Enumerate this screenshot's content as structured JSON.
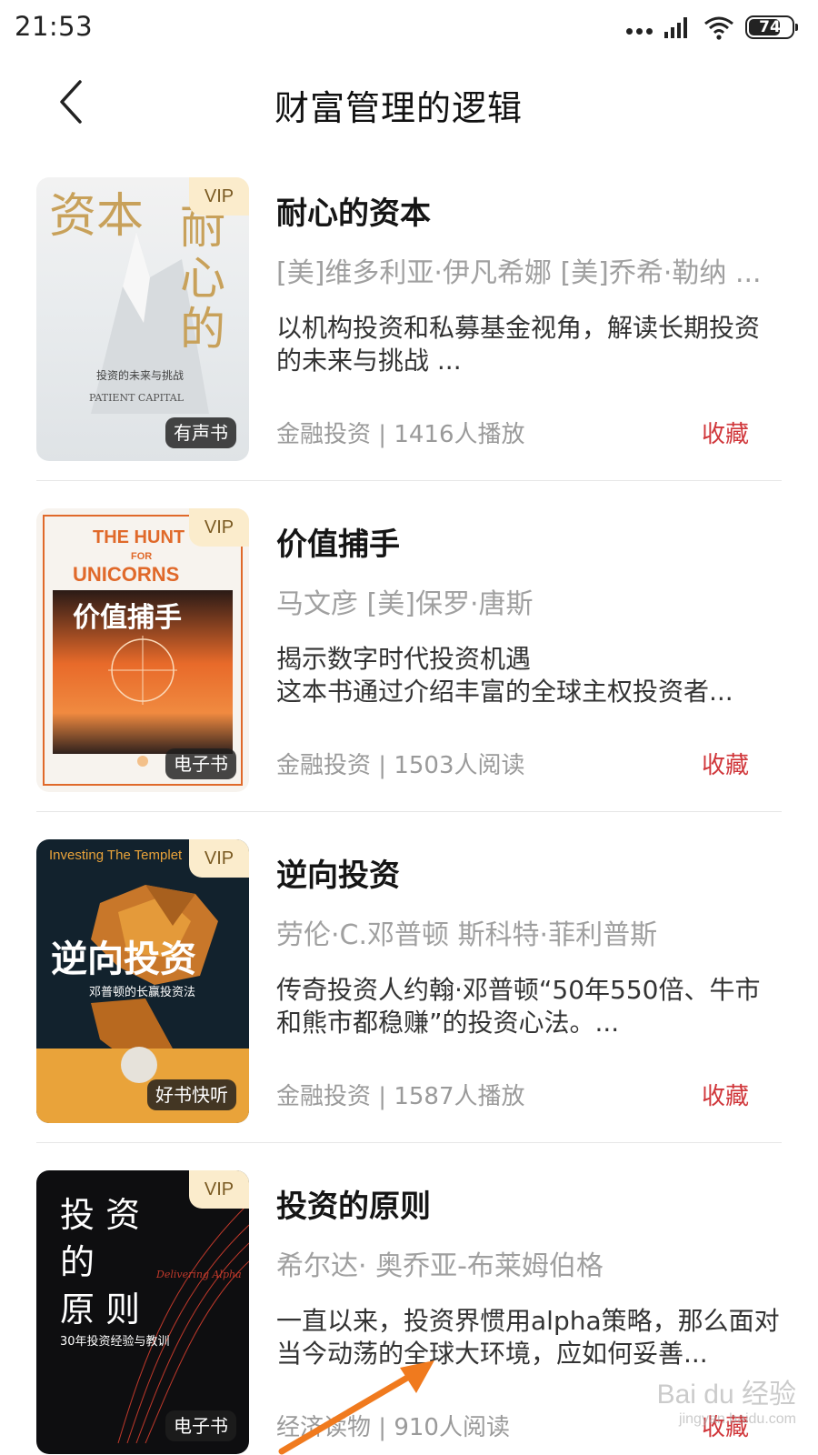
{
  "status_bar": {
    "time": "21:53",
    "battery": "74",
    "battery_level": 0.74
  },
  "header": {
    "back_icon": "chevron-left-icon",
    "title": "财富管理的逻辑"
  },
  "books": [
    {
      "title": "耐心的资本",
      "author": "[美]维多利亚·伊凡希娜 [美]乔希·勒纳 ...",
      "desc": "以机构投资和私募基金视角，解读长期投资的未来与挑战 ...",
      "category": "金融投资",
      "stats": "1416人播放",
      "vip": "VIP",
      "type": "有声书",
      "collect": "收藏",
      "cover": {
        "big_left": "资本",
        "big_right": "耐心的",
        "subtitle": "投资的未来与挑战",
        "en": "PATIENT CAPITAL"
      }
    },
    {
      "title": "价值捕手",
      "author": "马文彦 [美]保罗·唐斯",
      "desc": "揭示数字时代投资机遇\n这本书通过介绍丰富的全球主权投资者...",
      "category": "金融投资",
      "stats": "1503人阅读",
      "vip": "VIP",
      "type": "电子书",
      "collect": "收藏",
      "cover": {
        "en1": "THE HUNT",
        "en2": "FOR",
        "en3": "UNICORNS",
        "cn": "价值捕手"
      }
    },
    {
      "title": "逆向投资",
      "author": "劳伦·C.邓普顿 斯科特·菲利普斯",
      "desc": "传奇投资人约翰·邓普顿“50年550倍、牛市和熊市都稳赚”的投资心法。...",
      "category": "金融投资",
      "stats": "1587人播放",
      "vip": "VIP",
      "type": "好书快听",
      "collect": "收藏",
      "cover": {
        "en": "Investing The Templet",
        "cn": "逆向投资",
        "sub": "邓普顿的长赢投资法"
      }
    },
    {
      "title": "投资的原则",
      "author": "希尔达· 奥乔亚-布莱姆伯格",
      "desc": "一直以来，投资界惯用alpha策略，那么面对当今动荡的全球大环境，应如何妥善...",
      "category": "经济读物",
      "stats": "910人阅读",
      "vip": "VIP",
      "type": "电子书",
      "collect": "收藏",
      "cover": {
        "cn_a": "投 资",
        "cn_b": "的",
        "cn_c": "原 则",
        "sub": "30年投资经验与教训",
        "en": "Delivering Alpha"
      }
    }
  ],
  "watermark": {
    "main": "Bai du 经验",
    "sub": "jingyan.baidu.com"
  },
  "colors": {
    "accent_red": "#d0363a",
    "vip_bg": "#fbeccc",
    "meta_gray": "#9a9a9a"
  }
}
